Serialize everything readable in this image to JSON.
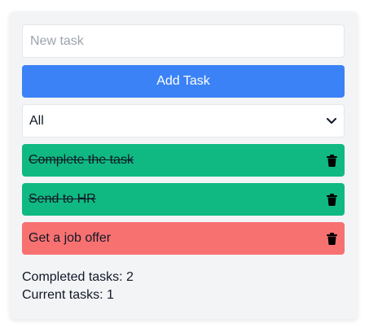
{
  "form": {
    "placeholder": "New task",
    "value": "",
    "add_label": "Add Task"
  },
  "filter": {
    "selected": "All"
  },
  "tasks": [
    {
      "label": "Complete the task",
      "completed": true,
      "color": "#10b981"
    },
    {
      "label": "Send to HR",
      "completed": true,
      "color": "#10b981"
    },
    {
      "label": "Get a job offer",
      "completed": false,
      "color": "#f87171"
    }
  ],
  "stats": {
    "completed_text": "Completed tasks: 2",
    "current_text": "Current tasks: 1"
  },
  "icons": {
    "delete": "trash-icon",
    "dropdown": "chevron-down-icon"
  },
  "colors": {
    "accent": "#3b82f6",
    "completed": "#10b981",
    "pending": "#f87171",
    "panel": "#f3f4f6"
  }
}
